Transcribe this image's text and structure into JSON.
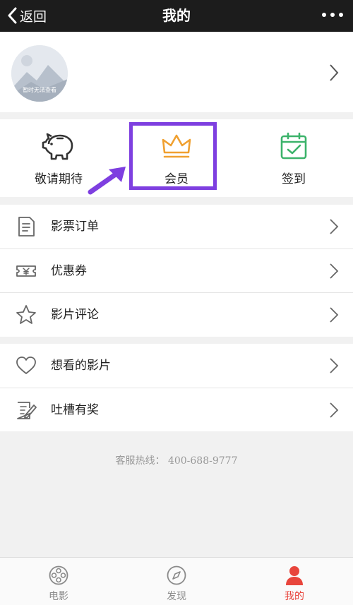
{
  "nav": {
    "back_label": "返回",
    "title": "我的"
  },
  "profile": {
    "avatar_caption": "暂时无法查看"
  },
  "quick_actions": [
    {
      "label": "敬请期待",
      "icon": "piggy-bank-icon"
    },
    {
      "label": "会员",
      "icon": "crown-icon"
    },
    {
      "label": "签到",
      "icon": "calendar-check-icon"
    }
  ],
  "menu_group_1": [
    {
      "label": "影票订单",
      "icon": "ticket-order-icon"
    },
    {
      "label": "优惠券",
      "icon": "coupon-icon"
    },
    {
      "label": "影片评论",
      "icon": "star-icon"
    }
  ],
  "menu_group_2": [
    {
      "label": "想看的影片",
      "icon": "heart-icon"
    },
    {
      "label": "吐槽有奖",
      "icon": "feedback-icon"
    }
  ],
  "hotline": "客服热线： 400-688-9777",
  "tabs": [
    {
      "label": "电影",
      "icon": "film-reel-icon",
      "active": false
    },
    {
      "label": "发现",
      "icon": "compass-icon",
      "active": false
    },
    {
      "label": "我的",
      "icon": "person-icon",
      "active": true
    }
  ],
  "colors": {
    "nav_bg": "#1c1c1c",
    "crown": "#f0a030",
    "calendar": "#3cb36b",
    "highlight": "#7e3fe0",
    "active_tab": "#e8453c"
  }
}
